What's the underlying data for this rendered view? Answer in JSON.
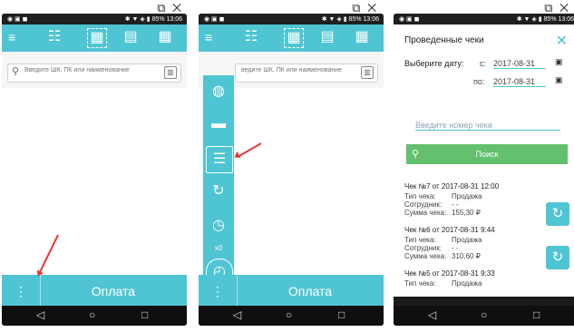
{
  "status_bar": {
    "left_icons": "◉ ▣ ◼",
    "right_text": "✱ ▼ ◈ ▮ 85% 13:06"
  },
  "window_controls": "⧉ ✕",
  "screen1": {
    "search_placeholder": "Введите ШК, ПК или наименование",
    "pay_button": "Оплата",
    "more_icon": "⋮"
  },
  "screen2": {
    "search_placeholder": "ведите ШК, ПК или наименование",
    "pay_button": "Оплата",
    "more_icon": "⋮",
    "multiplier": "x0"
  },
  "screen3": {
    "title": "Проведенные чеки",
    "select_date_label": "Выберите дату:",
    "from_label": "с:",
    "from_date": "2017-08-31",
    "to_label": "по:",
    "to_date": "2017-08-31",
    "receipt_placeholder": "Введите номер чека",
    "search_button": "Поиск",
    "receipts": [
      {
        "header": "Чек №7 от 2017-08-31 12:00",
        "type_label": "Тип чека:",
        "type": "Продажа",
        "employee_label": "Сотрудник:",
        "employee": "- -",
        "sum_label": "Сумма чека:",
        "sum": "155,30 ₽"
      },
      {
        "header": "Чек №6 от 2017-08-31 9:44",
        "type_label": "Тип чека:",
        "type": "Продажа",
        "employee_label": "Сотрудник:",
        "employee": "- -",
        "sum_label": "Сумма чека:",
        "sum": "310,60 ₽"
      },
      {
        "header": "Чек №5 от 2017-08-31 9:33",
        "type_label": "Тип чека:",
        "type": "Продажа"
      }
    ]
  },
  "colors": {
    "accent": "#4fc5d3",
    "green": "#63c06f",
    "arrow": "#e53935"
  }
}
